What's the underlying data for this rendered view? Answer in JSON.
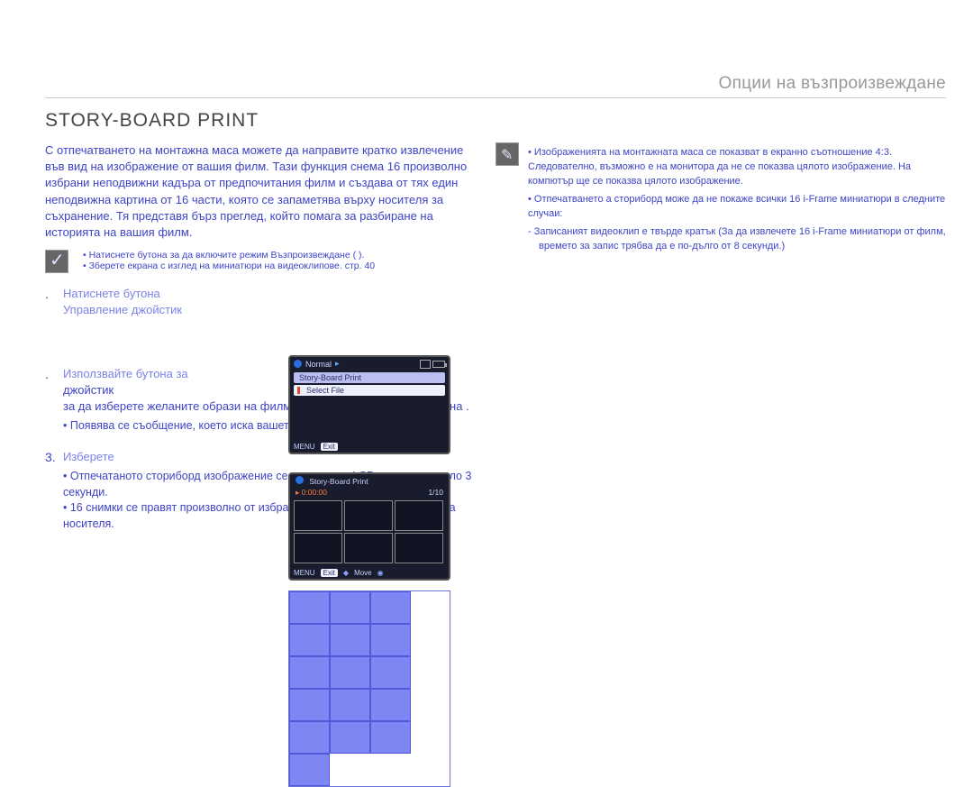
{
  "breadcrumb": "Опции на възпроизвеждане",
  "section_title": "STORY-BOARD PRINT",
  "intro": "С отпечатването на монтажна маса можете да направите кратко извлечение във вид на изображение от вашия филм. Тази функция снема 16 произволно избрани неподвижни кадъра от предпочитания филм и създава от тях един неподвижна картина от 16 части, която се запаметява върху носителя за съхранение. Тя представя бърз преглед, който помага за разбиране на историята на вашия филм.",
  "precheck": {
    "items": [
      "Натиснете бутона   за да включите режим Възпроизвеждане (   ).",
      "Зберете екрана с изглед на миниатюри на видеоклипове.   стр. 40"
    ]
  },
  "steps": {
    "s1": {
      "num": " .",
      "head": "Натиснете бутона   \n",
      "head2": "Управление джойстик",
      "tail": "               "
    },
    "s2": {
      "num": " .",
      "head": "Използвайте бутона за",
      "sub_head": "                    джойстик  \n",
      "body": "за да изберете желаните образи на филми и след това натиснете бутона  .",
      "bullet1": "Появява се съобщение, което иска вашето потвърждение."
    },
    "s3": {
      "num": "3.",
      "head": "Изберете  ",
      "bullet1": "Отпечатаното сториборд изображение се появява на LCD екрана за около 3 секунди.",
      "bullet2": "16 снимки се правят произволно от избрания видеоклип и се записват на носителя."
    }
  },
  "device1": {
    "mode": "Normal",
    "row1": "Story-Board Print",
    "row2": "Select File",
    "menu": "MENU",
    "exit": "Exit"
  },
  "device2": {
    "title": "Story-Board Print",
    "time": "0:00:00",
    "counter": "1/10",
    "menu": "MENU",
    "exit": "Exit",
    "move": "Move"
  },
  "note": {
    "head": "                \n            ",
    "items": [
      "Изображенията на монтажната маса се показват в екранно съотношение 4:3. Следователно, възможно е на монитора да не се показва цялото изображение. На компютър ще се показва цялото изображение.",
      "Отпечатването а сториборд може да не покаже всички 16 i-Frame миниатюри в следните случаи:"
    ],
    "dash": "Записаният видеоклип е твърде кратък (За да извлечете 16 i-Frame миниатюри от филм, времето за запис трябва да е по-дълго от 8 секунди.)"
  }
}
